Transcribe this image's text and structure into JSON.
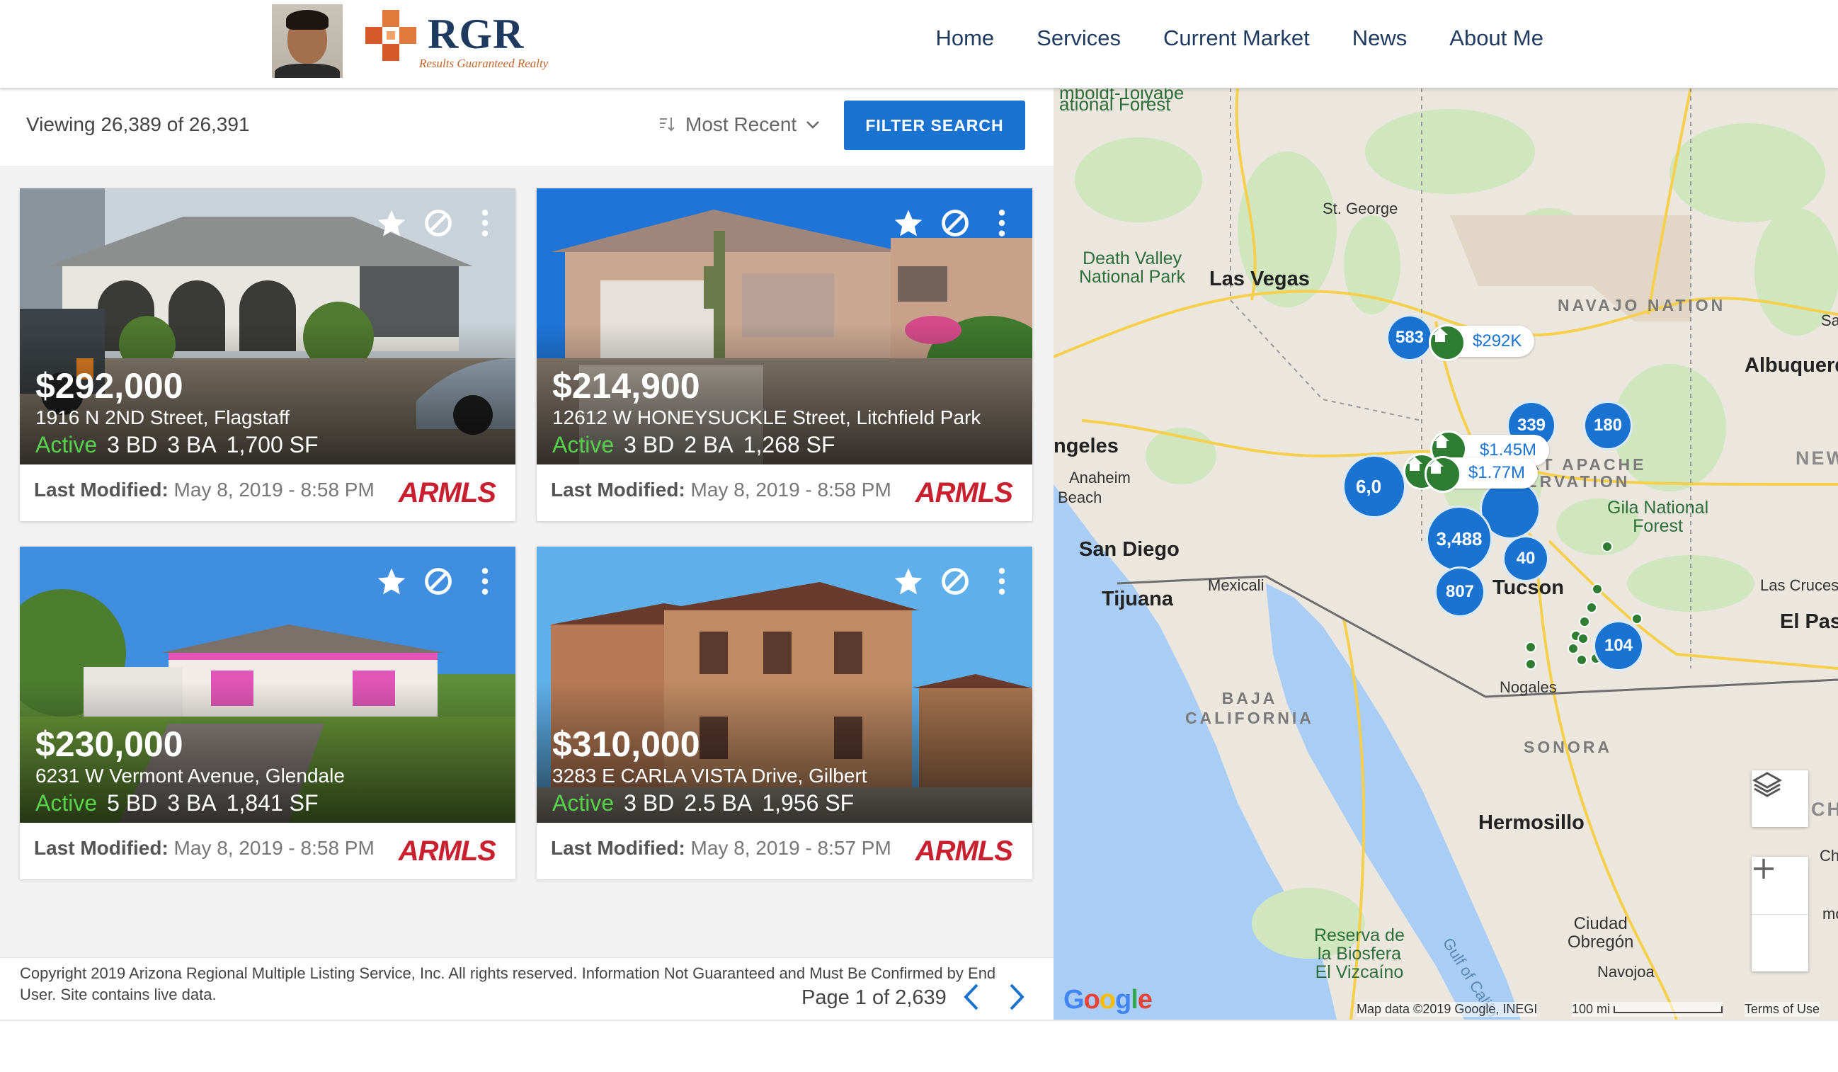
{
  "header": {
    "logo_text": "RGR",
    "logo_sub": "Results Guaranteed Realty",
    "nav": [
      "Home",
      "Services",
      "Current Market",
      "News",
      "About Me"
    ]
  },
  "toolbar": {
    "viewing": "Viewing 26,389 of 26,391",
    "sort_label": "Most Recent",
    "filter_button": "FILTER SEARCH"
  },
  "listings": [
    {
      "price": "$292,000",
      "address": "1916 N 2ND Street, Flagstaff",
      "status": "Active",
      "beds": "3 BD",
      "baths": "3 BA",
      "sqft": "1,700 SF",
      "modified_label": "Last Modified:",
      "modified": "May 8, 2019 - 8:58 PM",
      "source": "ARMLS"
    },
    {
      "price": "$214,900",
      "address": "12612 W HONEYSUCKLE Street, Litchfield Park",
      "status": "Active",
      "beds": "3 BD",
      "baths": "2 BA",
      "sqft": "1,268 SF",
      "modified_label": "Last Modified:",
      "modified": "May 8, 2019 - 8:58 PM",
      "source": "ARMLS"
    },
    {
      "price": "$230,000",
      "address": "6231 W Vermont Avenue, Glendale",
      "status": "Active",
      "beds": "5 BD",
      "baths": "3 BA",
      "sqft": "1,841 SF",
      "modified_label": "Last Modified:",
      "modified": "May 8, 2019 - 8:58 PM",
      "source": "ARMLS"
    },
    {
      "price": "$310,000",
      "address": "3283 E CARLA VISTA Drive, Gilbert",
      "status": "Active",
      "beds": "3 BD",
      "baths": "2.5 BA",
      "sqft": "1,956 SF",
      "modified_label": "Last Modified:",
      "modified": "May 8, 2019 - 8:57 PM",
      "source": "ARMLS"
    }
  ],
  "pager": {
    "text": "Page 1 of 2,639"
  },
  "copyright": "Copyright 2019 Arizona Regional Multiple Listing Service, Inc. All rights reserved. Information Not Guaranteed and Must Be Confirmed by End User. Site contains live data.",
  "map": {
    "clusters": [
      "583",
      "339",
      "180",
      "6,0",
      "3,488",
      "40",
      "807",
      "104"
    ],
    "price_tags": [
      "$292K",
      "$1.45M",
      "$1.77M"
    ],
    "places": {
      "humboldt": "mboldt-Toiyabe",
      "national_forest": "ational Forest",
      "st_george": "St. George",
      "death_valley": "Death Valley\nNational Park",
      "las_vegas": "Las Vegas",
      "navajo": "NAVAJO NATION",
      "sa": "Sa",
      "albuquerque": "Albuquerq",
      "angeles": "ngeles",
      "anaheim": "Anaheim",
      "beach": "Beach",
      "apache": "ORT APACHE\nSERVATION",
      "new": "NEW",
      "gila": "Gila National\nForest",
      "san_diego": "San Diego",
      "tijuana": "Tijuana",
      "mexicali": "Mexicali",
      "tucson": "Tucson",
      "las_cruces": "Las Cruces",
      "el_paso": "El Pas",
      "nogales": "Nogales",
      "baja": "BAJA\nCALIFORNIA",
      "sonora": "SONORA",
      "hermosillo": "Hermosillo",
      "chi": "CHI",
      "chih": "Chih",
      "moc": "moc",
      "reserva": "Reserva de\nla Biosfera\nEl Vizcaíno",
      "gulf": "Gulf of Califo",
      "obregon": "Ciudad\nObregón",
      "navojoa": "Navojoa"
    },
    "attribution": "Map data ©2019 Google, INEGI",
    "scale": "100 mi",
    "terms": "Terms of Use",
    "google": "Google"
  },
  "colors": {
    "accent": "#1a73d1",
    "active": "#57d24b",
    "armls": "#c8202f",
    "pin": "#2e7d32"
  }
}
